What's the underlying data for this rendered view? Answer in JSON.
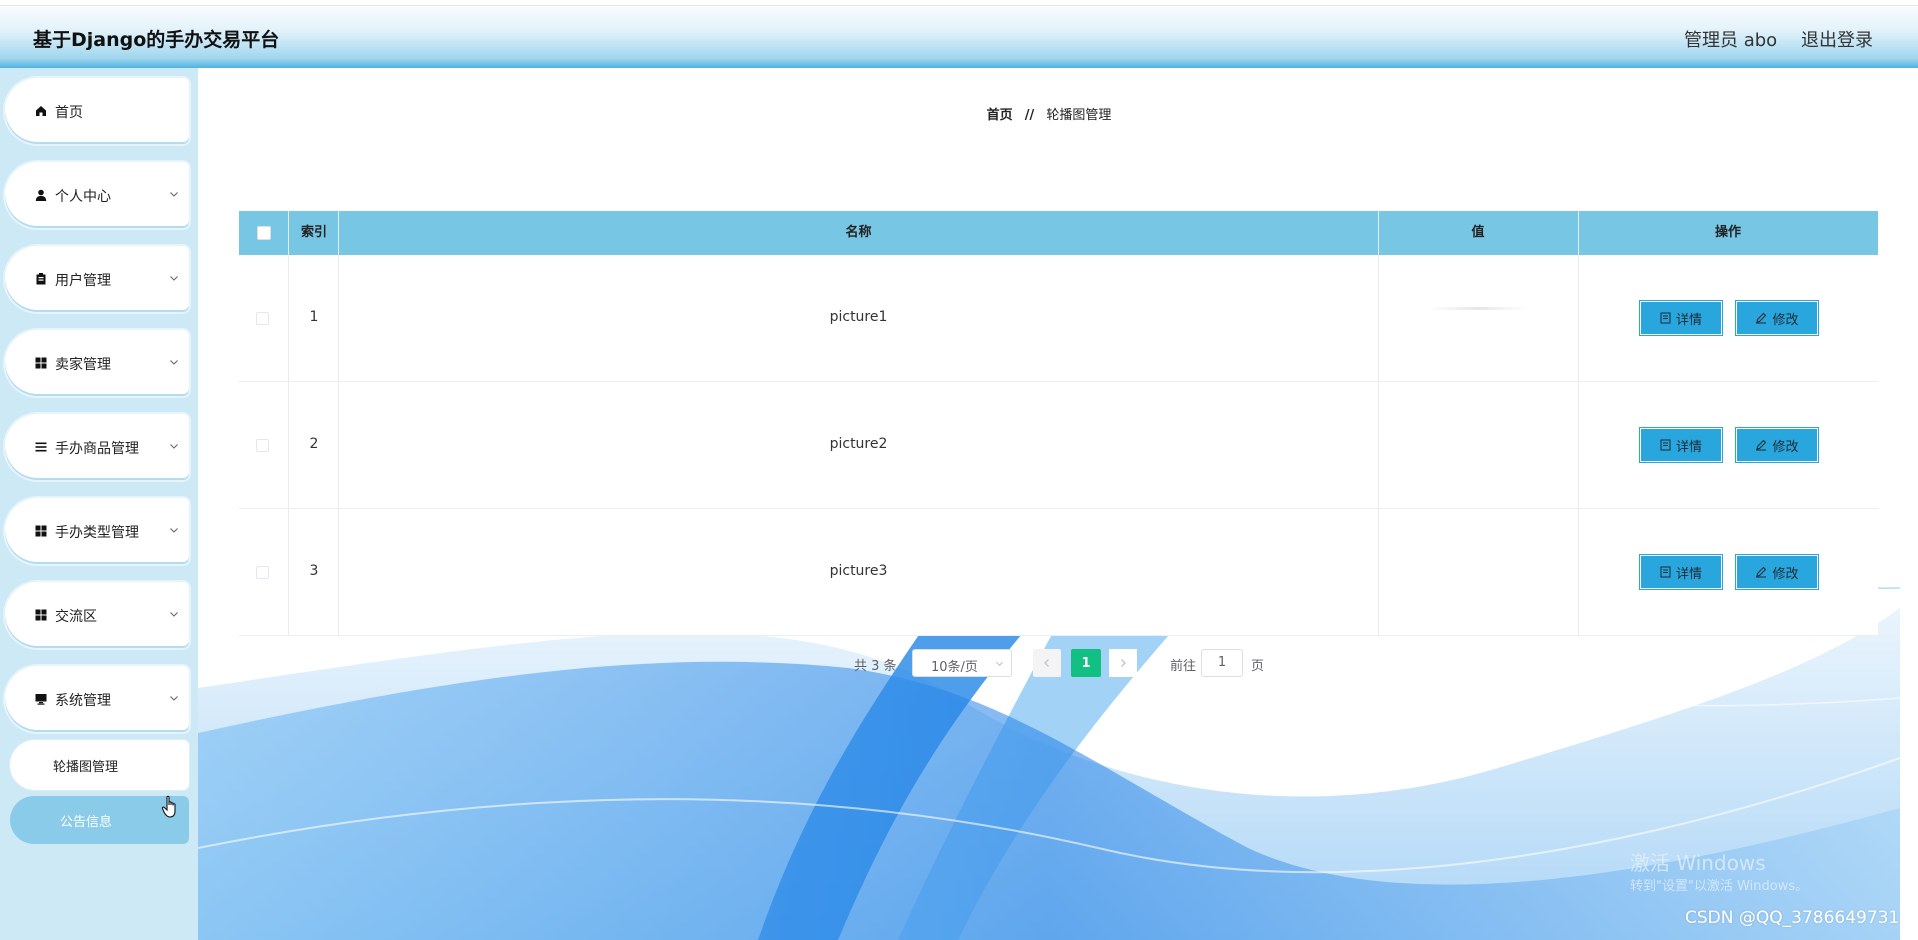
{
  "header": {
    "title": "基于Django的手办交易平台",
    "user_label": "管理员 abo",
    "logout_label": "退出登录"
  },
  "sidebar": {
    "items": [
      {
        "label": "首页",
        "icon": "home-icon"
      },
      {
        "label": "个人中心",
        "icon": "person-icon"
      },
      {
        "label": "用户管理",
        "icon": "clipboard-icon"
      },
      {
        "label": "卖家管理",
        "icon": "grid-icon"
      },
      {
        "label": "手办商品管理",
        "icon": "list-icon"
      },
      {
        "label": "手办类型管理",
        "icon": "grid-icon"
      },
      {
        "label": "交流区",
        "icon": "grid-icon"
      },
      {
        "label": "系统管理",
        "icon": "monitor-icon"
      }
    ],
    "sub_items": [
      {
        "label": "轮播图管理",
        "active": false
      },
      {
        "label": "公告信息",
        "active": true
      }
    ]
  },
  "breadcrumb": {
    "home": "首页",
    "separator": "//",
    "current": "轮播图管理"
  },
  "table": {
    "columns": [
      "索引",
      "名称",
      "值",
      "操作"
    ],
    "rows": [
      {
        "index": "1",
        "name": "picture1",
        "value": ""
      },
      {
        "index": "2",
        "name": "picture2",
        "value": ""
      },
      {
        "index": "3",
        "name": "picture3",
        "value": ""
      }
    ],
    "detail_label": "详情",
    "edit_label": "修改"
  },
  "pagination": {
    "total_label": "共 3 条",
    "page_size": "10条/页",
    "current_page": "1",
    "goto_label": "前往",
    "goto_value": "1",
    "page_suffix": "页"
  },
  "watermark": {
    "line1": "激活 Windows",
    "line2": "转到\"设置\"以激活 Windows。",
    "csdn": "CSDN @QQ_3786649731"
  },
  "colors": {
    "header_accent": "#4db3e0",
    "table_header": "#77c6e3",
    "button": "#29a6dd",
    "active_page": "#13c083",
    "sidebar_bg": "#cde9f6"
  }
}
